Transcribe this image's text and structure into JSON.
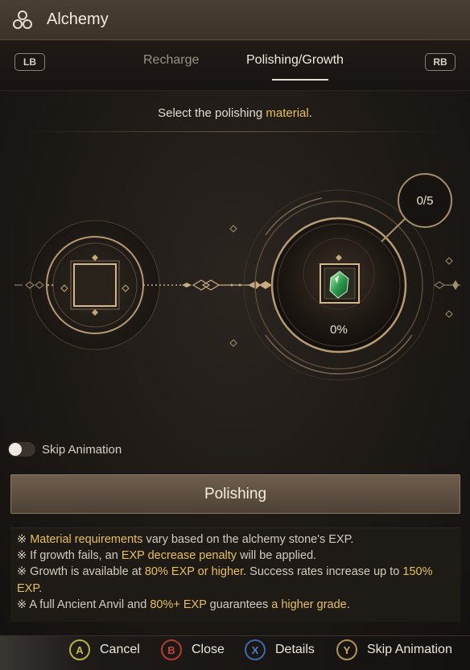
{
  "window": {
    "title": "Alchemy",
    "title_icon": "triskelion-icon"
  },
  "tabs": {
    "lb_label": "LB",
    "rb_label": "RB",
    "items": [
      {
        "label": "Recharge",
        "active": false
      },
      {
        "label": "Polishing/Growth",
        "active": true
      }
    ]
  },
  "instruction": {
    "prefix": "Select the polishing ",
    "highlight": "material",
    "suffix": "."
  },
  "slots": {
    "counter": "0/5",
    "percent": "0%",
    "material_icon": "green-gem-icon"
  },
  "skip_toggle": {
    "label": "Skip Animation",
    "on": false
  },
  "polish_button": {
    "label": "Polishing"
  },
  "notes": [
    {
      "mark": "※",
      "parts": [
        "",
        "Material requirements",
        " vary based on the alchemy stone's EXP."
      ]
    },
    {
      "mark": "※",
      "parts": [
        " If growth fails, an ",
        "EXP decrease penalty",
        " will be applied."
      ]
    },
    {
      "mark": "※",
      "parts": [
        " Growth is available at ",
        "80% EXP or higher",
        ". Success rates increase up to ",
        "150% EXP",
        "."
      ]
    },
    {
      "mark": "※",
      "parts": [
        " A full Ancient Anvil and ",
        "80%+ EXP",
        " guarantees ",
        "a higher grade",
        "."
      ]
    }
  ],
  "footer": [
    {
      "key": "A",
      "label": "Cancel"
    },
    {
      "key": "B",
      "label": "Close"
    },
    {
      "key": "X",
      "label": "Details"
    },
    {
      "key": "Y",
      "label": "Skip Animation"
    }
  ],
  "colors": {
    "accent": "#e9bf5c",
    "button": "#5c4e41",
    "bg": "#1d1915"
  }
}
